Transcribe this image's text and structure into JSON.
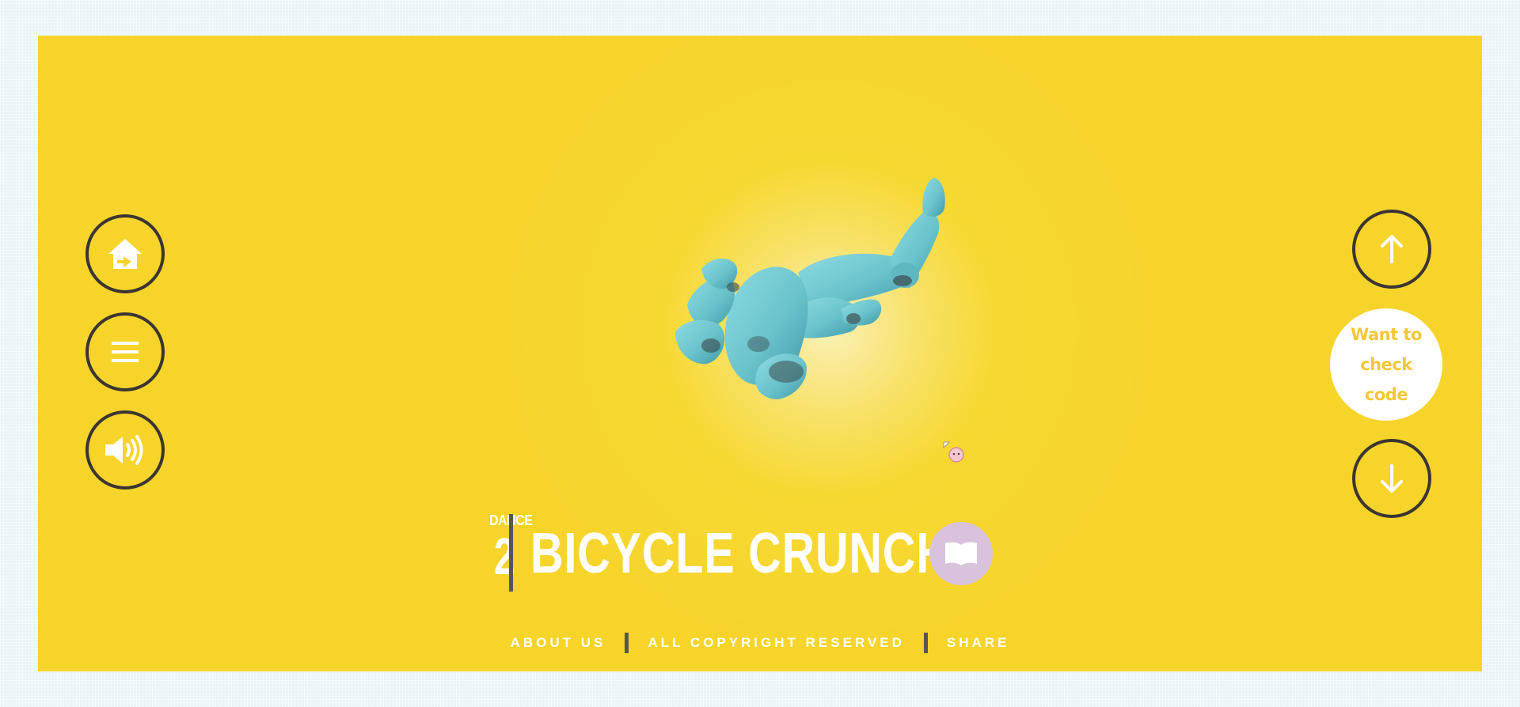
{
  "sidebar_left": {
    "items": [
      {
        "name": "home",
        "icon": "home-icon"
      },
      {
        "name": "menu",
        "icon": "menu-icon"
      },
      {
        "name": "sound",
        "icon": "speaker-icon"
      }
    ]
  },
  "sidebar_right": {
    "up_icon": "arrow-up-icon",
    "down_icon": "arrow-down-icon",
    "code_button_label": "Want to check code"
  },
  "title": {
    "label": "DANCE",
    "number": "2",
    "name": "BICYCLE CRUNCH",
    "book_icon": "book-icon"
  },
  "footer": {
    "about": "ABOUT US",
    "copyright": "ALL COPYRIGHT RESERVED",
    "share": "SHARE"
  },
  "colors": {
    "background": "#f6d42a",
    "figure": "#6fc7cf",
    "ring": "#3b3531",
    "code_text": "#f3c73a",
    "book_button": "#d8c2dc"
  }
}
